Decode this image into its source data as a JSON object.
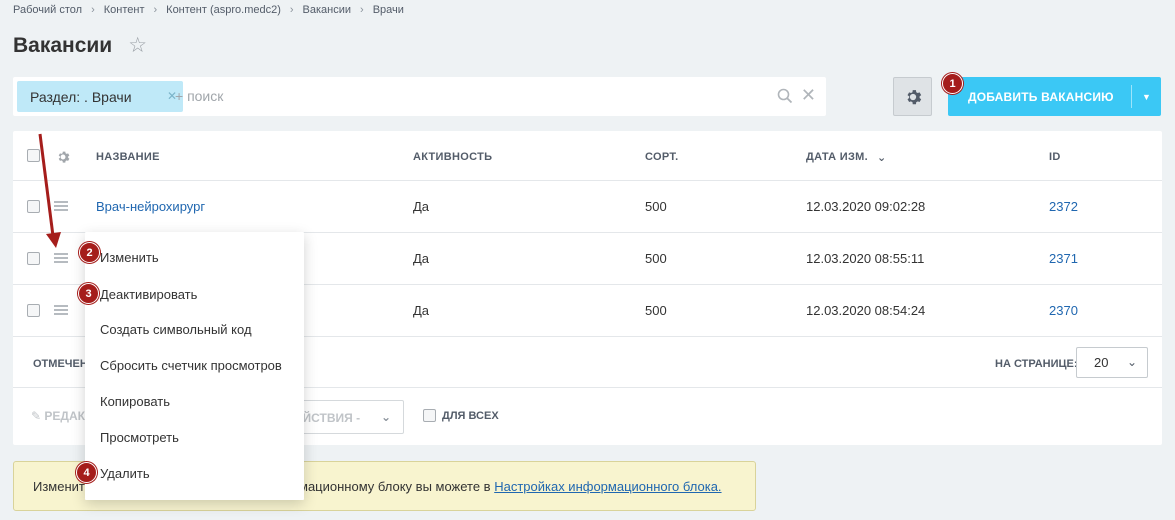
{
  "breadcrumbs": [
    "Рабочий стол",
    "Контент",
    "Контент (aspro.medc2)",
    "Вакансии",
    "Врачи"
  ],
  "page": {
    "title": "Вакансии"
  },
  "filter": {
    "tag_label": "Раздел: . Врачи",
    "search_placeholder": "+ поиск"
  },
  "toolbar": {
    "add_label": "ДОБАВИТЬ ВАКАНСИЮ"
  },
  "table": {
    "columns": [
      "НАЗВАНИЕ",
      "АКТИВНОСТЬ",
      "СОРТ.",
      "ДАТА ИЗМ.",
      "ID"
    ],
    "rows": [
      {
        "name": "Врач-нейрохирург",
        "active": "Да",
        "sort": "500",
        "date": "12.03.2020 09:02:28",
        "id": "2372"
      },
      {
        "name": "",
        "active": "Да",
        "sort": "500",
        "date": "12.03.2020 08:55:11",
        "id": "2371"
      },
      {
        "name": "",
        "active": "Да",
        "sort": "500",
        "date": "12.03.2020 08:54:24",
        "id": "2370"
      }
    ],
    "marked_label": "ОТМЕЧЕН",
    "per_page_label": "НА СТРАНИЦЕ:",
    "per_page_value": "20",
    "edit_label": "РЕДАК",
    "actions_label": "ДЕЙСТВИЯ -",
    "for_all_label": "ДЛЯ ВСЕХ"
  },
  "context_menu": {
    "items": [
      "Изменить",
      "Деактивировать",
      "Создать символьный код",
      "Сбросить счетчик просмотров",
      "Копировать",
      "Просмотреть",
      "Удалить"
    ]
  },
  "notice": {
    "text_left": "Изменит",
    "text_right": "мационному блоку вы можете в ",
    "link": "Настройках информационного блока."
  },
  "annotations": [
    "1",
    "2",
    "3",
    "4"
  ],
  "colors": {
    "accent": "#3bc8f5",
    "badge": "#a51d1b",
    "link": "#2067b0",
    "notice_bg": "#f8f4cf"
  }
}
